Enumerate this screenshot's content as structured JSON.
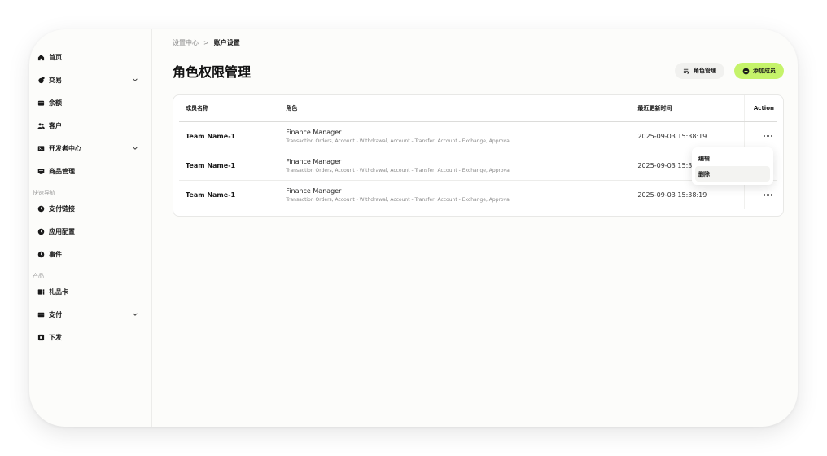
{
  "sidebar": {
    "items_top": [
      {
        "label": "首页",
        "icon": "home-icon",
        "chevron": false
      },
      {
        "label": "交易",
        "icon": "transaction-icon",
        "chevron": true
      },
      {
        "label": "余额",
        "icon": "wallet-icon",
        "chevron": false
      },
      {
        "label": "客户",
        "icon": "users-icon",
        "chevron": false
      },
      {
        "label": "开发者中心",
        "icon": "terminal-icon",
        "chevron": true
      },
      {
        "label": "商品管理",
        "icon": "product-icon",
        "chevron": false
      }
    ],
    "section_quick": "快速导航",
    "items_quick": [
      {
        "label": "支付链接",
        "icon": "clock-icon"
      },
      {
        "label": "应用配置",
        "icon": "clock-icon"
      },
      {
        "label": "事件",
        "icon": "clock-icon"
      }
    ],
    "section_product": "产品",
    "items_product": [
      {
        "label": "礼品卡",
        "icon": "gift-card-icon",
        "chevron": false
      },
      {
        "label": "支付",
        "icon": "card-icon",
        "chevron": true
      },
      {
        "label": "下发",
        "icon": "payout-icon",
        "chevron": false
      }
    ]
  },
  "breadcrumb": {
    "parent": "设置中心",
    "separator": ">",
    "current": "账户设置"
  },
  "page": {
    "title": "角色权限管理",
    "role_manage_label": "角色管理",
    "add_member_label": "添加成员"
  },
  "table": {
    "headers": {
      "name": "成员名称",
      "role": "角色",
      "time": "最近更新时间",
      "action": "Action"
    },
    "rows": [
      {
        "name": "Team Name-1",
        "role": "Finance Manager",
        "permissions": "Transaction Orders, Account - Withdrawal, Account - Transfer, Account - Exchange, Approval",
        "updated": "2025-09-03 15:38:19"
      },
      {
        "name": "Team Name-1",
        "role": "Finance Manager",
        "permissions": "Transaction Orders, Account - Withdrawal, Account - Transfer, Account - Exchange, Approval",
        "updated": "2025-09-03 15:38:19"
      },
      {
        "name": "Team Name-1",
        "role": "Finance Manager",
        "permissions": "Transaction Orders, Account - Withdrawal, Account - Transfer, Account - Exchange, Approval",
        "updated": "2025-09-03 15:38:19"
      }
    ]
  },
  "menu": {
    "edit": "编辑",
    "delete": "删除"
  },
  "colors": {
    "accent": "#c5f36a",
    "secondary_button": "#f1f1ef"
  }
}
